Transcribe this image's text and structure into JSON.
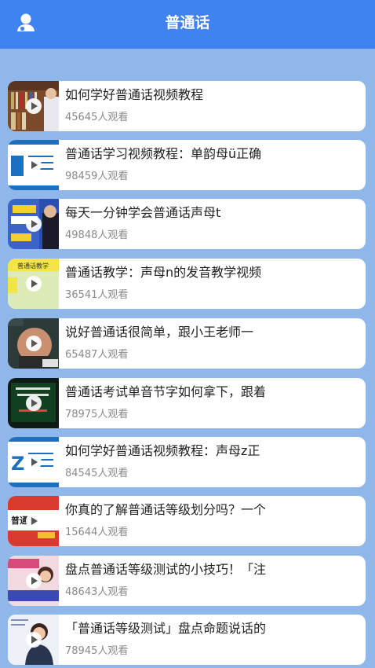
{
  "header": {
    "title": "普通话",
    "user_icon": "user-icon"
  },
  "videos": [
    {
      "title": "如何学好普通话视频教程",
      "views": "45645人观看"
    },
    {
      "title": "普通话学习视频教程：单韵母ü正确",
      "views": "98459人观看"
    },
    {
      "title": "每天一分钟学会普通话声母t",
      "views": "49848人观看"
    },
    {
      "title": "普通话教学：声母n的发音教学视频",
      "views": "36541人观看"
    },
    {
      "title": "说好普通话很简单，跟小王老师一",
      "views": "65487人观看"
    },
    {
      "title": "普通话考试单音节字如何拿下，跟着",
      "views": "78975人观看"
    },
    {
      "title": "如何学好普通话视频教程：声母z正",
      "views": "84545人观看"
    },
    {
      "title": "你真的了解普通话等级划分吗？一个",
      "views": "15644人观看"
    },
    {
      "title": "盘点普通话等级测试的小技巧！「注",
      "views": "48643人观看"
    },
    {
      "title": "「普通话等级测试」盘点命题说话的",
      "views": "78945人观看"
    }
  ],
  "thumb_text": [
    "普通话",
    "普通话教学",
    "Z"
  ],
  "colors": {
    "header": "#3f82f0",
    "background": "#8fb7ea"
  }
}
